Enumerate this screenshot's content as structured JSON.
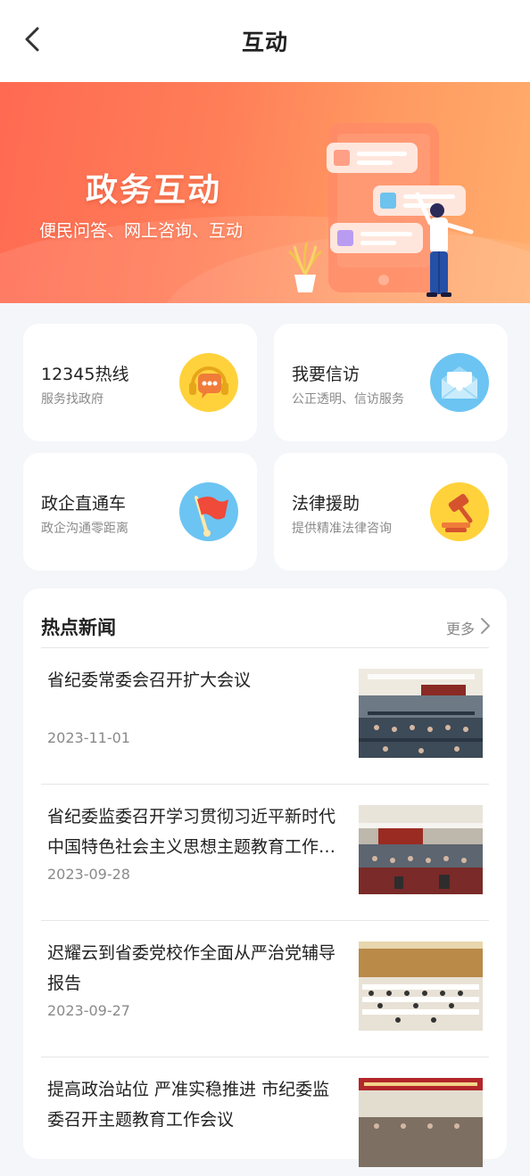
{
  "header": {
    "title": "互动",
    "back_icon": "chevron-left-icon"
  },
  "banner": {
    "title": "政务互动",
    "subtitle": "便民问答、网上咨询、互动",
    "colors": {
      "start": "#ff6a52",
      "end": "#ffad6c"
    }
  },
  "services": [
    {
      "title": "12345热线",
      "subtitle": "服务找政府",
      "icon": "headset-chat-icon",
      "icon_color": "#ffd23c"
    },
    {
      "title": "我要信访",
      "subtitle": "公正透明、信访服务",
      "icon": "envelope-icon",
      "icon_color": "#6cc4f2"
    },
    {
      "title": "政企直通车",
      "subtitle": "政企沟通零距离",
      "icon": "flag-icon",
      "icon_color": "#6cc4f2"
    },
    {
      "title": "法律援助",
      "subtitle": "提供精准法律咨询",
      "icon": "gavel-icon",
      "icon_color": "#ffd23c"
    }
  ],
  "news": {
    "title": "热点新闻",
    "more_label": "更多",
    "items": [
      {
        "title": "省纪委常委会召开扩大会议",
        "date": "2023-11-01"
      },
      {
        "title": "省纪委监委召开学习贯彻习近平新时代中国特色社会主义思想主题教育工作会议",
        "date": "2023-09-28"
      },
      {
        "title": "迟耀云到省委党校作全面从严治党辅导报告",
        "date": "2023-09-27"
      },
      {
        "title": "提高政治站位 严准实稳推进 市纪委监委召开主题教育工作会议",
        "date": ""
      }
    ]
  }
}
